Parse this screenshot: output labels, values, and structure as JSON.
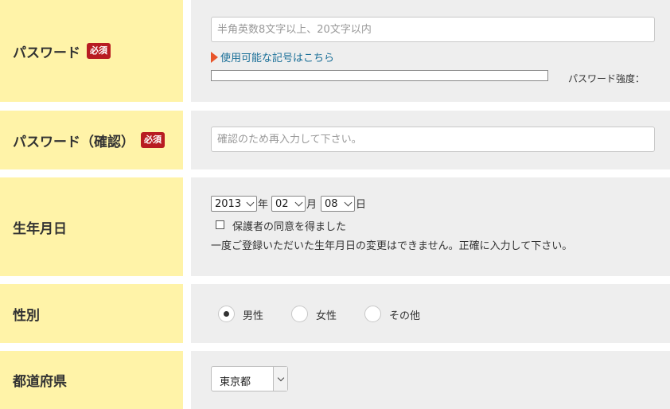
{
  "password": {
    "label": "パスワード",
    "required": "必須",
    "placeholder": "半角英数8文字以上、20文字以内",
    "symbols_link": "使用可能な記号はこちら",
    "strength_label": "パスワード強度："
  },
  "password_confirm": {
    "label": "パスワード（確認）",
    "required": "必須",
    "placeholder": "確認のため再入力して下さい。"
  },
  "birthday": {
    "label": "生年月日",
    "year": "2013",
    "year_unit": "年",
    "month": "02",
    "month_unit": "月",
    "day": "08",
    "day_unit": "日",
    "consent_label": "保護者の同意を得ました",
    "note": "一度ご登録いただいた生年月日の変更はできません。正確に入力して下さい。"
  },
  "gender": {
    "label": "性別",
    "options": [
      "男性",
      "女性",
      "その他"
    ],
    "selected": "男性"
  },
  "prefecture": {
    "label": "都道府県",
    "value": "東京都"
  }
}
